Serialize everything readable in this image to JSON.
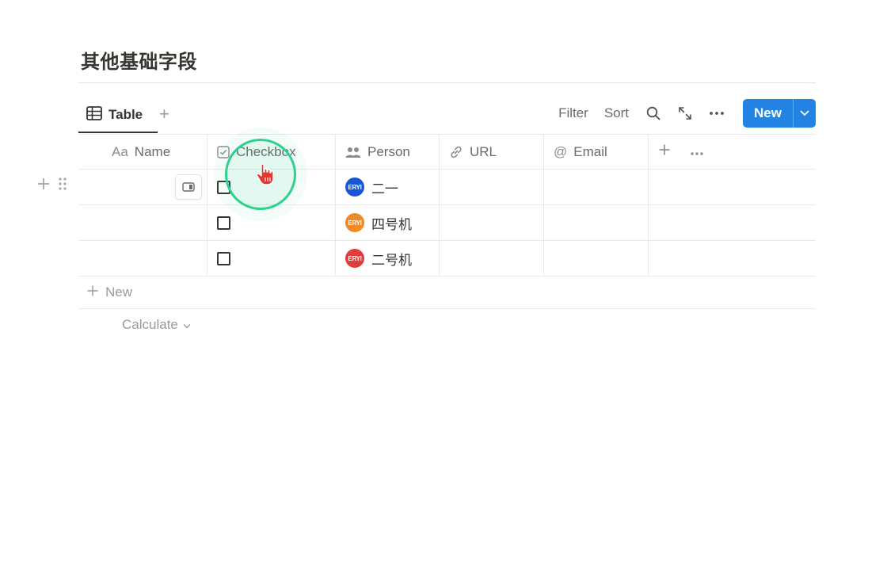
{
  "page": {
    "title": "其他基础字段"
  },
  "views": {
    "active_tab": "Table",
    "add_label": "+"
  },
  "toolbar": {
    "filter": "Filter",
    "sort": "Sort",
    "new": "New"
  },
  "columns": [
    {
      "label": "Name",
      "icon": "text-icon",
      "icon_text": "Aa"
    },
    {
      "label": "Checkbox",
      "icon": "checkbox-icon"
    },
    {
      "label": "Person",
      "icon": "people-icon"
    },
    {
      "label": "URL",
      "icon": "link-icon"
    },
    {
      "label": "Email",
      "icon": "at-icon",
      "icon_text": "@"
    }
  ],
  "rows": [
    {
      "name": "",
      "checked": false,
      "person": {
        "avatar_text": "ERYI",
        "avatar_color": "#1857d6",
        "name": "二一"
      },
      "url": "",
      "email": ""
    },
    {
      "name": "",
      "checked": false,
      "person": {
        "avatar_text": "ERYI",
        "avatar_color": "#f08a24",
        "name": "四号机"
      },
      "url": "",
      "email": ""
    },
    {
      "name": "",
      "checked": false,
      "person": {
        "avatar_text": "ERYI",
        "avatar_color": "#e03e3e",
        "name": "二号机"
      },
      "url": "",
      "email": ""
    }
  ],
  "footer": {
    "new_row": "New",
    "calculate": "Calculate"
  },
  "colors": {
    "accent": "#2383e2",
    "cursor_ring": "#2fd18f"
  }
}
